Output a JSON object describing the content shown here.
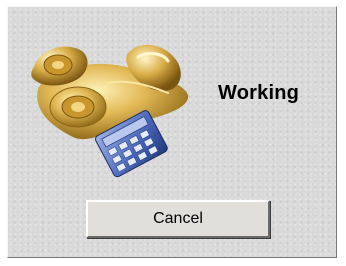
{
  "dialog": {
    "status_text": "Working",
    "cancel_label": "Cancel"
  },
  "icons": {
    "telephone": "telephone-icon",
    "calculator": "calculator-icon"
  },
  "colors": {
    "background": "#d9d9d9",
    "phone_gold": "#d4a941",
    "calculator_blue": "#3d5aa8",
    "button_face": "#e2dfdb"
  }
}
